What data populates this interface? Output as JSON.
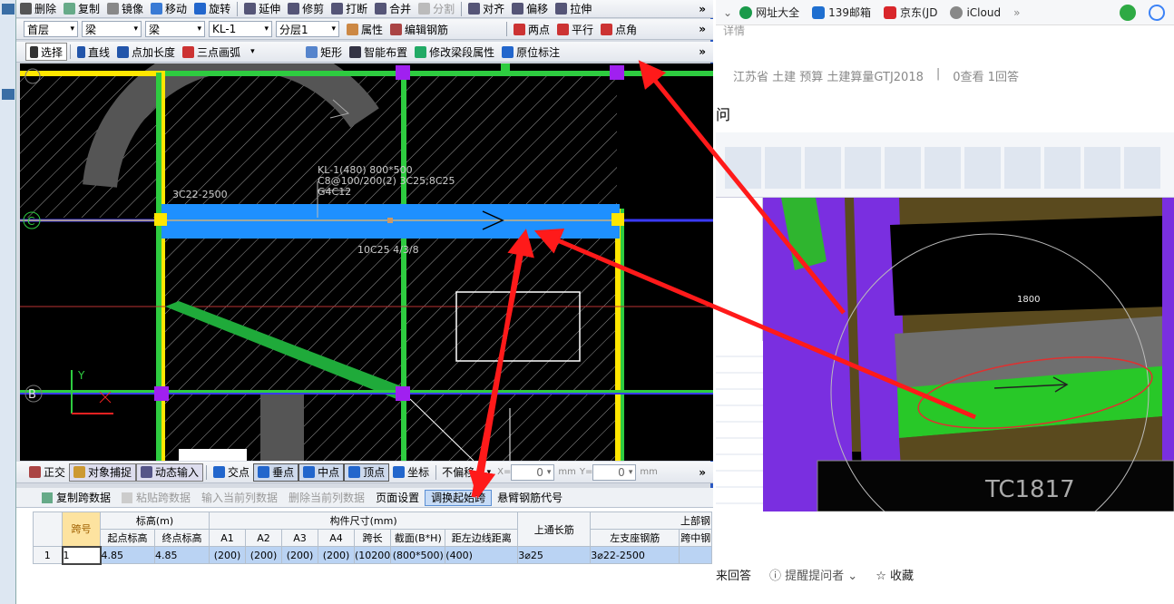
{
  "toolbar1": [
    "删除",
    "复制",
    "镜像",
    "移动",
    "旋转",
    "延伸",
    "修剪",
    "打断",
    "合并",
    "分割",
    "对齐",
    "偏移",
    "拉伸"
  ],
  "toolbar2": {
    "floor": "首层",
    "category": "梁",
    "type": "梁",
    "element": "KL-1",
    "layer": "分层1",
    "props": "属性",
    "edit_rebar": "编辑钢筋",
    "two_pt": "两点",
    "parallel": "平行",
    "point_angle": "点角"
  },
  "toolbar3": {
    "select": "选择",
    "line": "直线",
    "point_len": "点加长度",
    "arc": "三点画弧",
    "rect": "矩形",
    "smart": "智能布置",
    "modify_span": "修改梁段属性",
    "orig_label": "原位标注"
  },
  "canvas": {
    "label1": "KL-1(480) 800*500",
    "label2": "C8@100/200(2) 3C25;8C25",
    "label3": "G4C12",
    "label4": "3C22-2500",
    "label5": "10C25 4/3/8",
    "axis_b": "B",
    "axis_c": "C",
    "axis_y": "Y"
  },
  "snapbar": {
    "ortho": "正交",
    "obj_snap": "对象捕捉",
    "dyn_input": "动态输入",
    "intersect": "交点",
    "perp": "垂点",
    "mid": "中点",
    "vertex": "顶点",
    "coord": "坐标",
    "no_offset": "不偏移",
    "x_label": "X=",
    "x_val": "0",
    "y_label": "Y=",
    "y_val": "0",
    "unit": "mm"
  },
  "gridtb": [
    "复制跨数据",
    "粘贴跨数据",
    "输入当前列数据",
    "删除当前列数据",
    "页面设置",
    "调换起始跨",
    "悬臂钢筋代号"
  ],
  "table": {
    "span": "跨号",
    "elev": "标高(m)",
    "dims": "构件尺寸(mm)",
    "top_through": "上通长筋",
    "top_rebar": "上部钢",
    "start_elev": "起点标高",
    "end_elev": "终点标高",
    "a1": "A1",
    "a2": "A2",
    "a3": "A3",
    "a4": "A4",
    "span_len": "跨长",
    "section": "截面(B*H)",
    "left_dist": "距左边线距离",
    "left_seat": "左支座钢筋",
    "mid": "跨中钢",
    "row": [
      "1",
      "1",
      "4.85",
      "4.85",
      "(200)",
      "(200)",
      "(200)",
      "(200)",
      "(10200",
      "(800*500)",
      "(400)",
      "3⌀25",
      "3⌀22-2500",
      ""
    ]
  },
  "browser": {
    "bookmarks": [
      "网址大全",
      "139邮箱",
      "京东(JD",
      "iCloud"
    ],
    "tags": "江苏省  土建  预算  土建算量GTJ2018",
    "views": "0查看  1回答",
    "detail": "详情",
    "q": "问",
    "ruler": "1800",
    "tc": "TC1817",
    "answer": "来回答",
    "remind": "提醒提问者",
    "fav": "收藏"
  },
  "colors": {
    "accent": "#2b59c3",
    "arrow": "#ff1a1a",
    "beam": "#1e90ff",
    "green": "#2ecc40"
  }
}
